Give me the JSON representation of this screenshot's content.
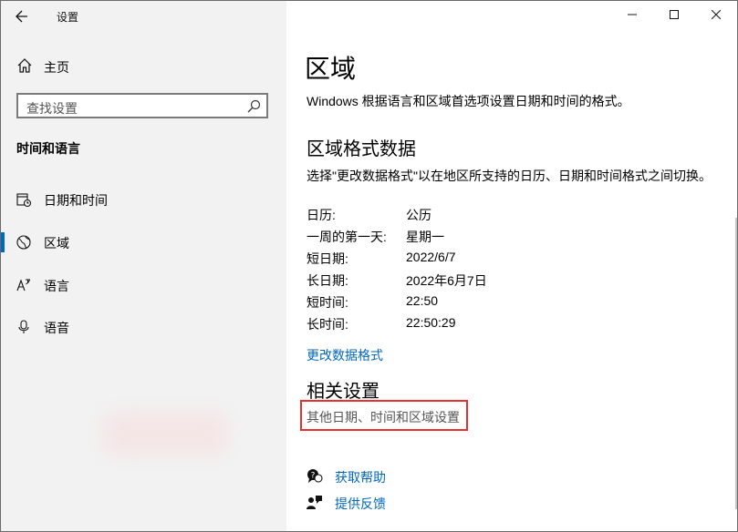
{
  "window": {
    "title": "设置"
  },
  "sidebar": {
    "home_label": "主页",
    "search_placeholder": "查找设置",
    "section_title": "时间和语言",
    "items": [
      {
        "label": "日期和时间",
        "icon": "calendar-icon",
        "selected": false
      },
      {
        "label": "区域",
        "icon": "globe-icon",
        "selected": true
      },
      {
        "label": "语言",
        "icon": "language-icon",
        "selected": false
      },
      {
        "label": "语音",
        "icon": "microphone-icon",
        "selected": false
      }
    ]
  },
  "main": {
    "title": "区域",
    "description": "Windows 根据语言和区域首选项设置日期和时间的格式。",
    "format_heading": "区域格式数据",
    "format_description": "选择\"更改数据格式\"以在地区所支持的日历、日期和时间格式之间切换。",
    "format_rows": [
      {
        "label": "日历:",
        "value": "公历"
      },
      {
        "label": "一周的第一天:",
        "value": "星期一"
      },
      {
        "label": "短日期:",
        "value": "2022/6/7"
      },
      {
        "label": "长日期:",
        "value": "2022年6月7日"
      },
      {
        "label": "短时间:",
        "value": "22:50"
      },
      {
        "label": "长时间:",
        "value": "22:50:29"
      }
    ],
    "change_format_link": "更改数据格式",
    "related_heading": "相关设置",
    "related_link": "其他日期、时间和区域设置",
    "get_help": "获取帮助",
    "give_feedback": "提供反馈"
  },
  "colors": {
    "accent": "#0067c0",
    "highlight_border": "#e53030",
    "sidebar_bg": "#f2f2f2"
  }
}
